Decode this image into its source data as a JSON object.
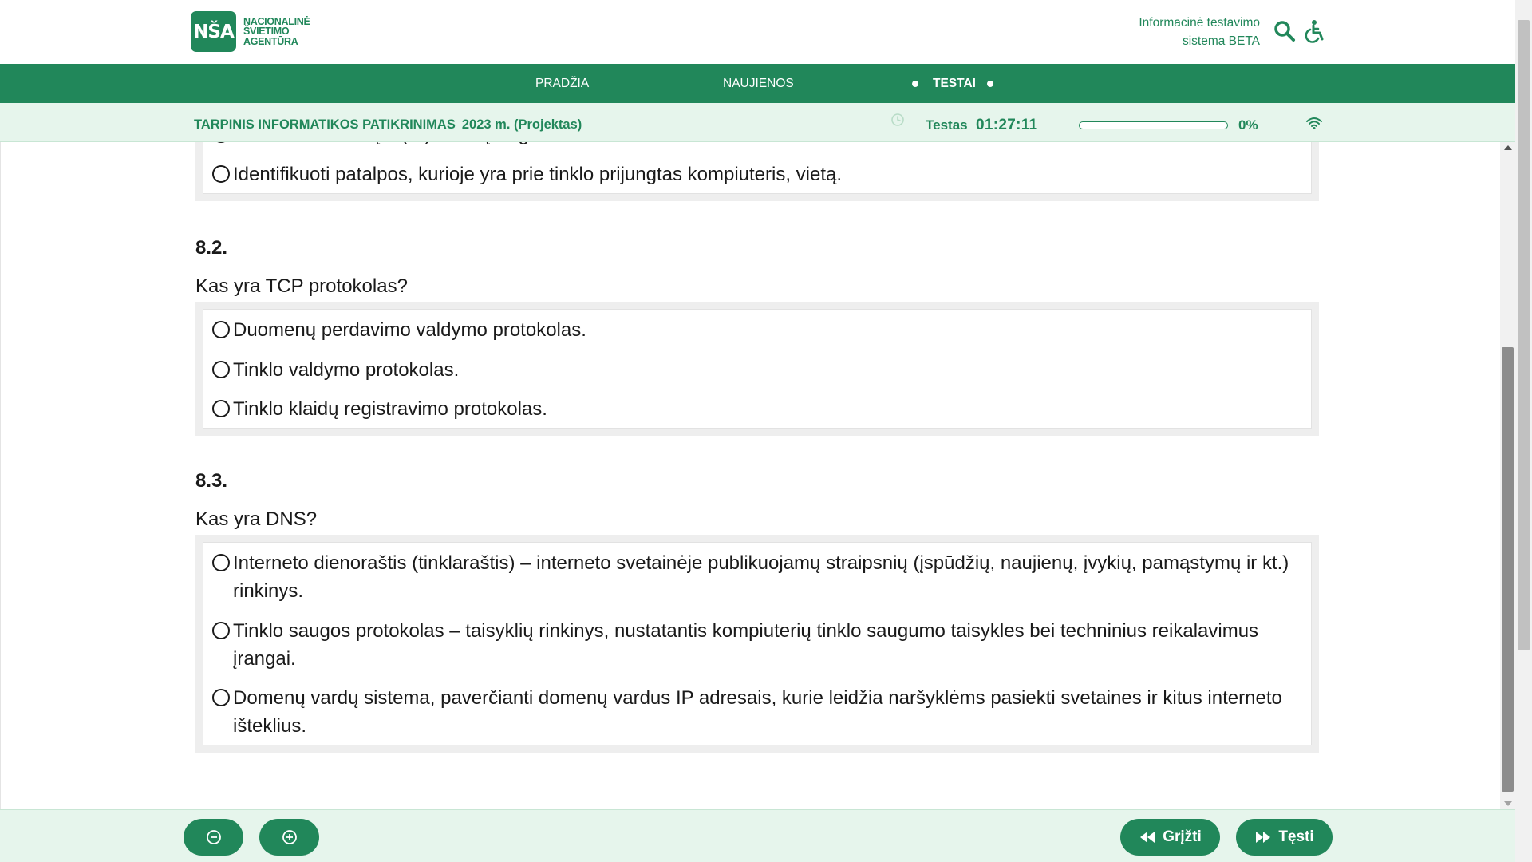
{
  "header": {
    "logo_mark": "NŠA",
    "logo_lines": [
      "Nacionalinė",
      "švietimo",
      "agentūra"
    ],
    "system_name_line1": "Informacinė testavimo",
    "system_name_line2": "sistema BETA",
    "icons": [
      "search-icon",
      "accessibility-icon"
    ]
  },
  "nav": {
    "items": [
      {
        "label": "PRADŽIA"
      },
      {
        "label": "NAUJIENOS"
      },
      {
        "label": "TESTAI",
        "active": true
      }
    ]
  },
  "test_bar": {
    "title": "TARPINIS INFORMATIKOS PATIKRINIMAS",
    "year": "2023 m. (Projektas)",
    "timer_label": "Testas",
    "timer_value": "01:27:11",
    "progress_value": 0,
    "progress_label": "0%"
  },
  "questions": [
    {
      "partial_option": "Identifikuoti tinklą ir (ar) tinklo įrenginius.",
      "options": [
        "Identifikuoti patalpos, kurioje yra prie tinklo prijungtas kompiuteris, vietą."
      ]
    },
    {
      "number": "8.2.",
      "text": "Kas yra TCP protokolas?",
      "options": [
        "Duomenų perdavimo valdymo protokolas.",
        "Tinklo valdymo protokolas.",
        "Tinklo klaidų registravimo protokolas."
      ]
    },
    {
      "number": "8.3.",
      "text": "Kas yra DNS?",
      "options": [
        "Interneto dienoraštis (tinklaraštis) – interneto svetainėje publikuojamų straipsnių (įspūdžių, naujienų, įvykių, pamąstymų ir kt.) rinkinys.",
        "Tinklo saugos protokolas – taisyklių rinkinys, nustatantis kompiuterių tinklo saugumo taisykles bei techninius reikalavimus įrangai.",
        "Domenų vardų sistema, paverčianti domenų vardus IP adresais, kurie leidžia naršyklėms pasiekti svetaines ir kitus interneto išteklius."
      ]
    }
  ],
  "footer": {
    "zoom_out_icon": "zoom-out-icon",
    "zoom_in_icon": "zoom-in-icon",
    "back_label": "Grįžti",
    "next_label": "Tęsti"
  },
  "colors": {
    "brand_green": "#21875a",
    "light_green": "#e6f5ec"
  }
}
